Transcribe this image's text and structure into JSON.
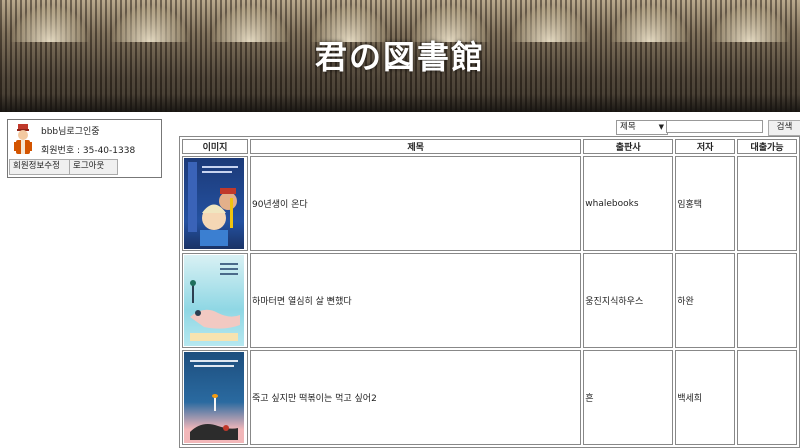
{
  "site": {
    "title": "君の図書館"
  },
  "user": {
    "login_text": "bbb님로그인중",
    "member_number": "회원번호 : 35-40-1338",
    "edit_button": "회원정보수정",
    "logout_button": "로그아웃"
  },
  "search": {
    "field_selected": "제목",
    "query_value": "",
    "button_label": "검색"
  },
  "table": {
    "headers": {
      "image": "이미지",
      "title": "제목",
      "publisher": "출판사",
      "author": "저자",
      "available": "대출가능"
    },
    "rows": [
      {
        "title": "90년생이 온다",
        "publisher": "whalebooks",
        "author": "임홍택",
        "available": ""
      },
      {
        "title": "하마터면 열심히 살 뻔했다",
        "publisher": "웅진지식하우스",
        "author": "하완",
        "available": ""
      },
      {
        "title": "죽고 싶지만 떡볶이는 먹고 싶어2",
        "publisher": "흔",
        "author": "백세희",
        "available": ""
      }
    ]
  },
  "colors": {
    "banner_text": "#ffffff",
    "border": "#888888"
  }
}
